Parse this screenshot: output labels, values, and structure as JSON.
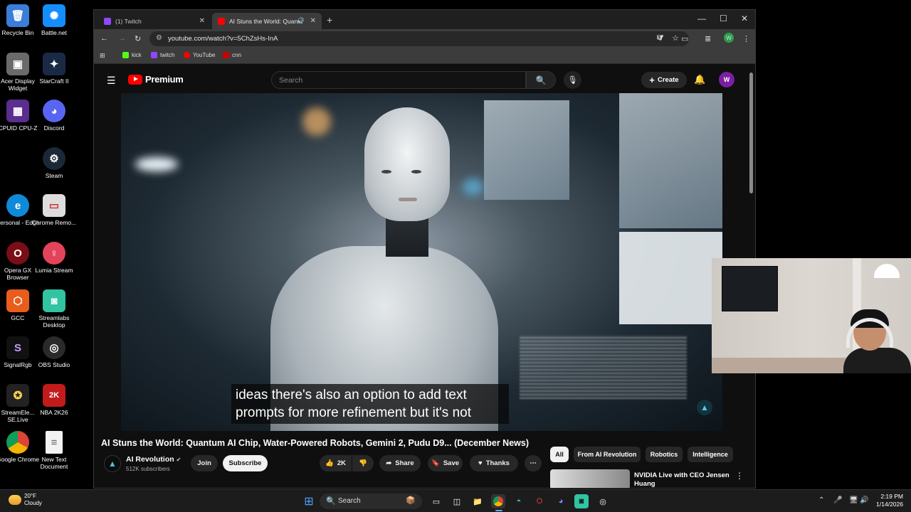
{
  "desktop": {
    "icons": [
      {
        "label": "Recycle Bin",
        "color": "#3b7dd8",
        "glyph": "🗑"
      },
      {
        "label": "Battle.net",
        "color": "#148eff",
        "glyph": "✺"
      },
      {
        "label": "Acer Display Widget",
        "color": "#6a6a6a",
        "glyph": "▣"
      },
      {
        "label": "StarCraft II",
        "color": "#1b2a44",
        "glyph": "✦"
      },
      {
        "label": "CPUID CPU-Z",
        "color": "#5a2d8f",
        "glyph": "▦"
      },
      {
        "label": "Discord",
        "color": "#5865f2",
        "glyph": "◕"
      },
      {
        "label": "Steam",
        "color": "#1b2838",
        "glyph": "⚙"
      },
      {
        "label": "Personal - Edge",
        "color": "#0f8ad8",
        "glyph": "e"
      },
      {
        "label": "Chrome Remo...",
        "color": "#dddddd",
        "glyph": "▭"
      },
      {
        "label": "Opera GX Browser",
        "color": "#7a0e17",
        "glyph": "O"
      },
      {
        "label": "Lumia Stream",
        "color": "#e4435c",
        "glyph": "♀"
      },
      {
        "label": "GCC",
        "color": "#e85d1c",
        "glyph": "⬡"
      },
      {
        "label": "Streamlabs Desktop",
        "color": "#31c3a2",
        "glyph": "◙"
      },
      {
        "label": "SignalRgb",
        "color": "#111111",
        "glyph": "S"
      },
      {
        "label": "OBS Studio",
        "color": "#2a2a2a",
        "glyph": "◎"
      },
      {
        "label": "StreamEle... SE.Live",
        "color": "#222222",
        "glyph": "✪"
      },
      {
        "label": "NBA 2K26",
        "color": "#c21b1b",
        "glyph": "2K"
      },
      {
        "label": "Google Chrome",
        "color": "#3a8f3a",
        "glyph": "◉"
      },
      {
        "label": "New Text Document",
        "color": "#f2f2f2",
        "glyph": "≡"
      }
    ]
  },
  "browser": {
    "tabs": [
      {
        "label": "(1) Twitch",
        "color": "#9146ff"
      },
      {
        "label": "AI Stuns the World: Quantu",
        "color": "#ff0000"
      }
    ],
    "url": "youtube.com/watch?v=5ChZsHs-InA",
    "profile_letter": "W",
    "bookmarks": [
      {
        "label": "kick",
        "color": "#53fc18"
      },
      {
        "label": "twitch",
        "color": "#9146ff"
      },
      {
        "label": "YouTube",
        "color": "#ff0000"
      },
      {
        "label": "cnn",
        "color": "#cc0000"
      }
    ]
  },
  "youtube": {
    "logo_text": "Premium",
    "search_placeholder": "Search",
    "create_label": "Create",
    "avatar_letter": "W",
    "caption_line1": "ideas there's also an option to add text",
    "caption_line2": "prompts for more refinement but it's not",
    "video_title": "AI Stuns the World: Quantum AI Chip, Water-Powered Robots, Gemini 2, Pudu D9... (December News)",
    "channel_name": "AI Revolution",
    "subscribers": "512K subscribers",
    "join_label": "Join",
    "subscribe_label": "Subscribe",
    "likes": "2K",
    "share_label": "Share",
    "save_label": "Save",
    "thanks_label": "Thanks",
    "chips": [
      "All",
      "From AI Revolution",
      "Robotics",
      "Intelligence"
    ],
    "recommended_title": "NVIDIA Live with CEO Jensen Huang"
  },
  "taskbar": {
    "temperature": "20°F",
    "condition": "Cloudy",
    "search_label": "Search",
    "time": "2:19 PM",
    "date": "1/14/2026"
  }
}
